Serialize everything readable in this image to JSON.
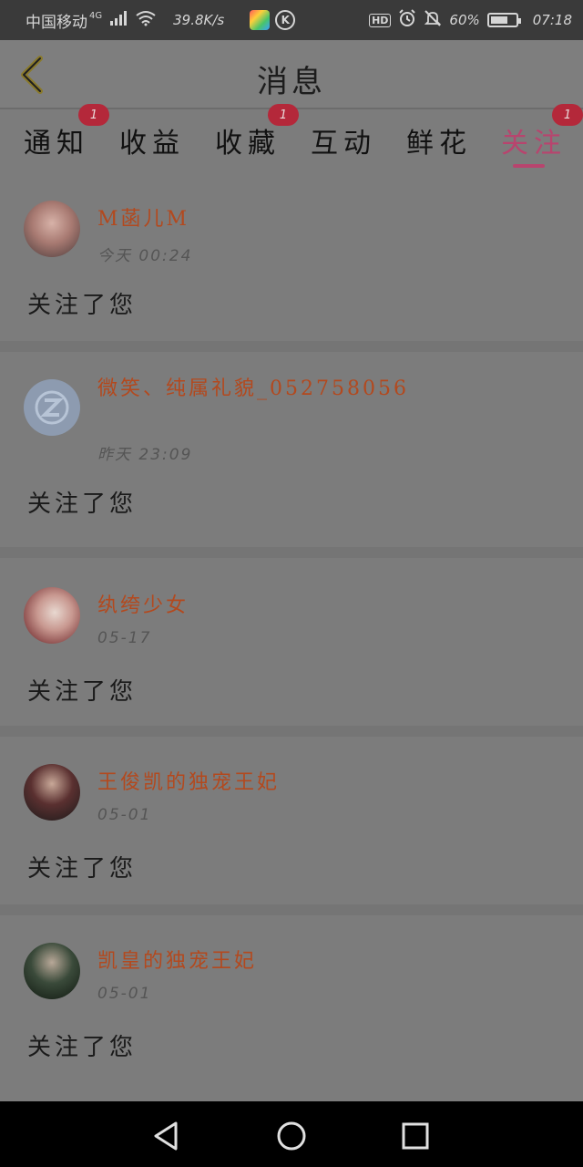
{
  "status_bar": {
    "carrier": "中国移动",
    "network": "4G",
    "speed": "39.8K/s",
    "battery": "60%",
    "time": "07:18",
    "icons": [
      "signal-icon",
      "wifi-icon",
      "app-icon",
      "k-app-icon",
      "hd-icon",
      "alarm-icon",
      "mute-icon",
      "battery-icon"
    ]
  },
  "header": {
    "title": "消息"
  },
  "tabs": [
    {
      "label": "通知",
      "badge": "1"
    },
    {
      "label": "收益",
      "badge": ""
    },
    {
      "label": "收藏",
      "badge": "1"
    },
    {
      "label": "互动",
      "badge": ""
    },
    {
      "label": "鲜花",
      "badge": ""
    },
    {
      "label": "关注",
      "badge": "1",
      "active": true
    }
  ],
  "items": [
    {
      "user": "M菡儿M",
      "time": "今天  00:24",
      "action": "关注了您"
    },
    {
      "user": "微笑、纯属礼貌_052758056",
      "time": "昨天  23:09",
      "action": "关注了您"
    },
    {
      "user": "纨绔少女",
      "time": "05-17",
      "action": "关注了您"
    },
    {
      "user": "王俊凯的独宠王妃",
      "time": "05-01",
      "action": "关注了您"
    },
    {
      "user": "凯皇的独宠王妃",
      "time": "05-01",
      "action": "关注了您"
    }
  ],
  "colors": {
    "accent": "#b8446e",
    "username": "#b3491e",
    "badge": "#b4283a"
  }
}
